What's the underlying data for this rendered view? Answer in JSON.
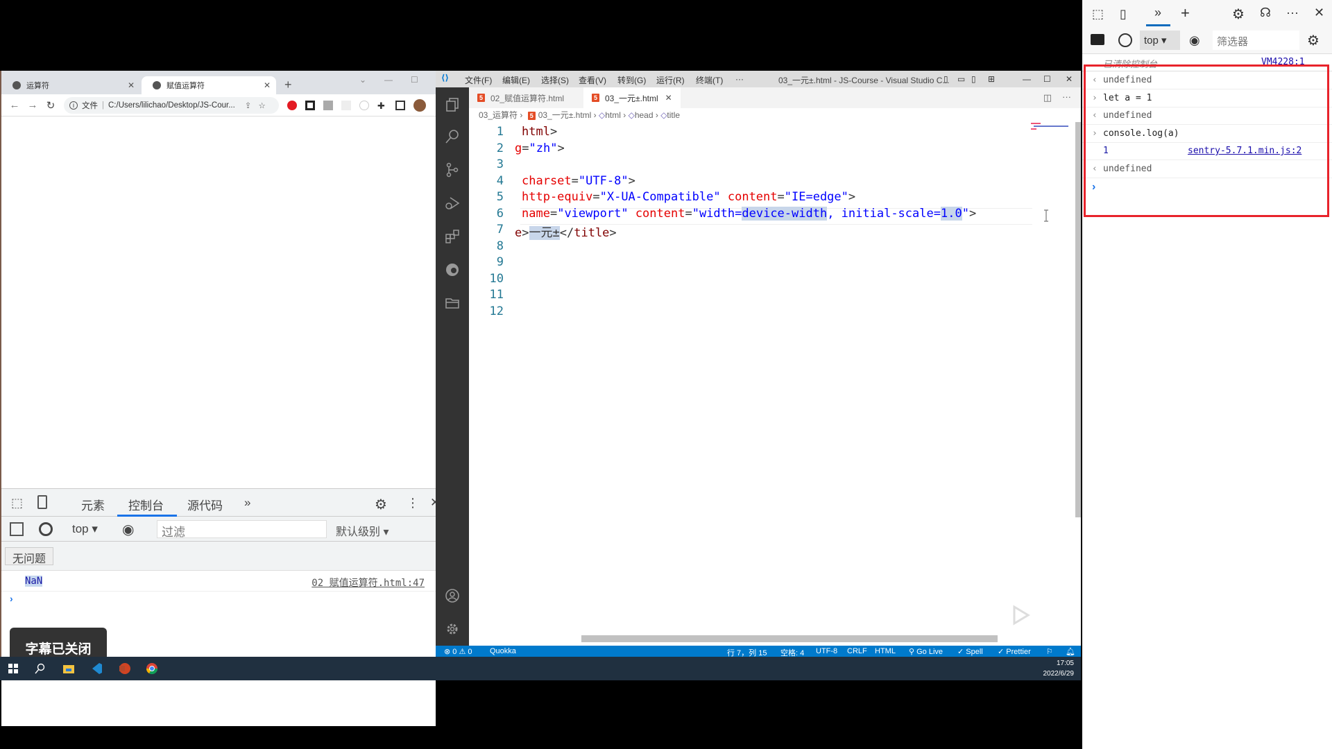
{
  "chrome": {
    "tabs": [
      {
        "label": "运算符"
      },
      {
        "label": "赋值运算符"
      }
    ],
    "address_scheme": "文件",
    "address": "C:/Users/lilichao/Desktop/JS-Cour...",
    "devtools": {
      "tabs": [
        "元素",
        "控制台",
        "源代码"
      ],
      "active_tab": "控制台",
      "context": "top",
      "filter_placeholder": "过滤",
      "level": "默认级别",
      "issues": "无问题",
      "log": [
        {
          "value": "NaN",
          "source": "02 赋值运算符.html:47"
        }
      ],
      "prompt": "›"
    }
  },
  "subtitle_toast": "字幕已关闭",
  "vscode": {
    "menu": [
      "文件(F)",
      "编辑(E)",
      "选择(S)",
      "查看(V)",
      "转到(G)",
      "运行(R)",
      "终端(T)",
      "···"
    ],
    "window_title": "03_一元±.html - JS-Course - Visual Studio C...",
    "tabs": [
      {
        "label": "02_赋值运算符.html",
        "active": false
      },
      {
        "label": "03_一元±.html",
        "active": true
      }
    ],
    "breadcrumb": [
      "03_运算符",
      "03_一元±.html",
      "html",
      "head",
      "title"
    ],
    "lines": [
      {
        "n": "1",
        "parts": [
          [
            "t-tag",
            "html"
          ],
          [
            "t-txt",
            ">"
          ]
        ]
      },
      {
        "n": "2",
        "parts": [
          [
            "t-attr",
            "g"
          ],
          [
            "t-txt",
            "="
          ],
          [
            "t-str",
            "\"zh\""
          ],
          [
            "t-txt",
            ">"
          ]
        ]
      },
      {
        "n": "3",
        "parts": []
      },
      {
        "n": "4",
        "parts": [
          [
            "t-attr",
            "charset"
          ],
          [
            "t-txt",
            "="
          ],
          [
            "t-str",
            "\"UTF-8\""
          ],
          [
            "t-txt",
            ">"
          ]
        ]
      },
      {
        "n": "5",
        "parts": [
          [
            "t-attr",
            "http-equiv"
          ],
          [
            "t-txt",
            "="
          ],
          [
            "t-str",
            "\"X-UA-Compatible\""
          ],
          [
            "t-txt",
            " "
          ],
          [
            "t-attr",
            "content"
          ],
          [
            "t-txt",
            "="
          ],
          [
            "t-str",
            "\"IE=edge\""
          ],
          [
            "t-txt",
            ">"
          ]
        ]
      },
      {
        "n": "6",
        "parts": [
          [
            "t-attr",
            "name"
          ],
          [
            "t-txt",
            "="
          ],
          [
            "t-str",
            "\"viewport\""
          ],
          [
            "t-txt",
            " "
          ],
          [
            "t-attr",
            "content"
          ],
          [
            "t-txt",
            "="
          ],
          [
            "t-str",
            "\"width="
          ],
          [
            "t-str hl",
            "device-width"
          ],
          [
            "t-str",
            ", initial-scale="
          ],
          [
            "t-str hl",
            "1.0"
          ],
          [
            "t-str",
            "\""
          ],
          [
            "t-txt",
            ">"
          ]
        ]
      },
      {
        "n": "7",
        "parts": [
          [
            "t-tag",
            "e"
          ],
          [
            "t-txt",
            ">"
          ],
          [
            "t-txt hl",
            "一元±"
          ],
          [
            "t-txt",
            "</"
          ],
          [
            "t-tag",
            "title"
          ],
          [
            "t-txt",
            ">"
          ]
        ]
      },
      {
        "n": "8",
        "parts": []
      },
      {
        "n": "9",
        "parts": []
      },
      {
        "n": "10",
        "parts": []
      },
      {
        "n": "11",
        "parts": []
      },
      {
        "n": "12",
        "parts": []
      }
    ],
    "status": {
      "errors": "0",
      "warnings": "0",
      "quokka": "Quokka",
      "position": "行 7，列 15",
      "spaces": "空格: 4",
      "encoding": "UTF-8",
      "eol": "CRLF",
      "language": "HTML",
      "golive": "Go Live",
      "spell": "Spell",
      "prettier": "Prettier"
    }
  },
  "taskbar": {
    "time": "17:05",
    "date": "2022/6/29"
  },
  "edge_devtools": {
    "context": "top",
    "filter_placeholder": "筛选器",
    "cleared": "已清除控制台",
    "cleared_source": "VM4228:1",
    "entries": [
      {
        "kind": "result",
        "text": "undefined"
      },
      {
        "kind": "input",
        "text": "let a = 1"
      },
      {
        "kind": "result",
        "text": "undefined"
      },
      {
        "kind": "input",
        "text": "console.log(a)"
      },
      {
        "kind": "log",
        "text": "1",
        "source": "sentry-5.7.1.min.js:2"
      },
      {
        "kind": "result",
        "text": "undefined"
      }
    ]
  },
  "colors": {
    "accent": "#1a73e8",
    "vscode_status": "#007acc",
    "highlight_box": "#e8232b"
  }
}
